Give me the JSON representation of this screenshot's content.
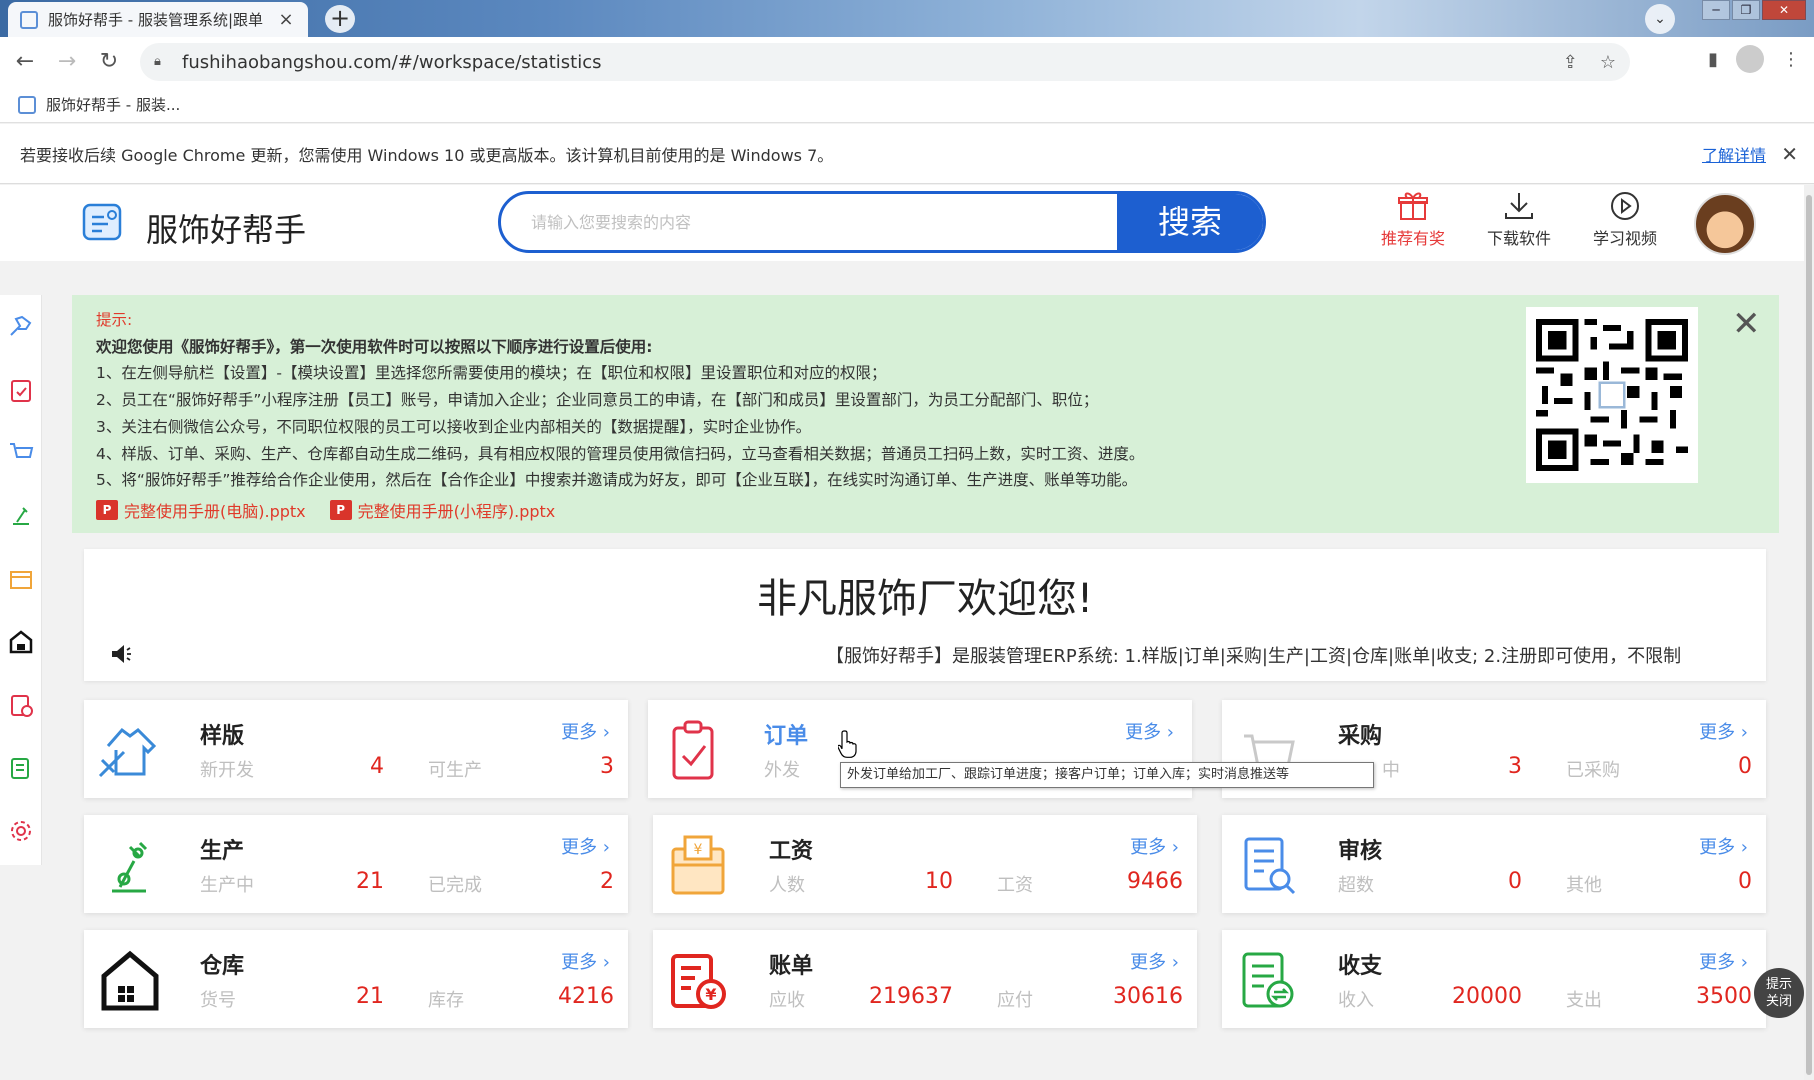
{
  "browser": {
    "tab_title": "服饰好帮手 - 服装管理系统|跟单",
    "new_tab": "+",
    "url": "fushihaobangshou.com/#/workspace/statistics",
    "bookmark": "服饰好帮手 - 服装...",
    "infobar_text": "若要接收后续 Google Chrome 更新，您需使用 Windows 10 或更高版本。该计算机目前使用的是 Windows 7。",
    "infobar_link": "了解详情"
  },
  "header": {
    "logo": "服饰好帮手",
    "search_placeholder": "请输入您要搜索的内容",
    "search_button": "搜索",
    "actions": [
      {
        "label": "推荐有奖",
        "icon": "gift-icon"
      },
      {
        "label": "下载软件",
        "icon": "download-icon"
      },
      {
        "label": "学习视频",
        "icon": "play-icon"
      }
    ]
  },
  "tip": {
    "title": "提示:",
    "intro": "欢迎您使用《服饰好帮手》，第一次使用软件时可以按照以下顺序进行设置后使用:",
    "lines": [
      "1、在左侧导航栏【设置】-【模块设置】里选择您所需要使用的模块；在【职位和权限】里设置职位和对应的权限；",
      "2、员工在“服饰好帮手”小程序注册【员工】账号，申请加入企业；企业同意员工的申请，在【部门和成员】里设置部门，为员工分配部门、职位；",
      "3、关注右侧微信公众号，不同职位权限的员工可以接收到企业内部相关的【数据提醒】，实时企业协作。",
      "4、样版、订单、采购、生产、仓库都自动生成二维码，具有相应权限的管理员使用微信扫码，立马查看相关数据；普通员工扫码上数，实时工资、进度。",
      "5、将“服饰好帮手”推荐给合作企业使用，然后在【合作企业】中搜索并邀请成为好友，即可【企业互联】，在线实时沟通订单、生产进度、账单等功能。"
    ],
    "files": [
      "完整使用手册(电脑).pptx",
      "完整使用手册(小程序).pptx"
    ],
    "ppt_badge": "P"
  },
  "welcome": {
    "title": "非凡服饰厂欢迎您!",
    "marquee": "【服饰好帮手】是服装管理ERP系统: 1.样版|订单|采购|生产|工资|仓库|账单|收支; 2.注册即可使用，不限制"
  },
  "more_label": "更多 ›",
  "cards": [
    {
      "title": "样版",
      "icon": "sample-icon",
      "l1": "新开发",
      "v1": "4",
      "l2": "可生产",
      "v2": "3"
    },
    {
      "title": "订单",
      "icon": "order-icon",
      "l1": "外发",
      "v1": "",
      "l2": "",
      "v2": ""
    },
    {
      "title": "采购",
      "icon": "cart-icon",
      "l1": "中",
      "v1": "3",
      "l2": "已采购",
      "v2": "0"
    },
    {
      "title": "生产",
      "icon": "production-icon",
      "l1": "生产中",
      "v1": "21",
      "l2": "已完成",
      "v2": "2"
    },
    {
      "title": "工资",
      "icon": "wage-icon",
      "l1": "人数",
      "v1": "10",
      "l2": "工资",
      "v2": "9466"
    },
    {
      "title": "审核",
      "icon": "audit-icon",
      "l1": "超数",
      "v1": "0",
      "l2": "其他",
      "v2": "0"
    },
    {
      "title": "仓库",
      "icon": "warehouse-icon",
      "l1": "货号",
      "v1": "21",
      "l2": "库存",
      "v2": "4216"
    },
    {
      "title": "账单",
      "icon": "bill-icon",
      "l1": "应收",
      "v1": "219637",
      "l2": "应付",
      "v2": "30616"
    },
    {
      "title": "收支",
      "icon": "income-icon",
      "l1": "收入",
      "v1": "20000",
      "l2": "支出",
      "v2": "3500"
    }
  ],
  "tooltip": "外发订单给加工厂、跟踪订单进度；接客户订单；订单入库；实时消息推送等",
  "float_tip": [
    "提示",
    "关闭"
  ]
}
